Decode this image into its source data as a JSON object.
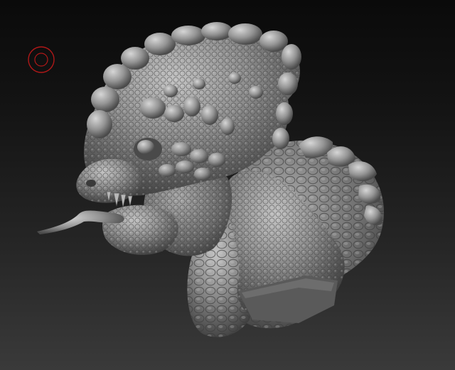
{
  "viewport": {
    "background_top": "#0a0a0a",
    "background_bottom": "#3a3a3a",
    "model_color": "#8e8e8e",
    "model_shadow": "#3c3c3c",
    "model_highlight": "#c4c4c4"
  },
  "brush_cursor": {
    "icon": "brush-circle-icon",
    "color": "#b01818"
  },
  "model": {
    "icon": "sculpt-mesh-icon"
  }
}
